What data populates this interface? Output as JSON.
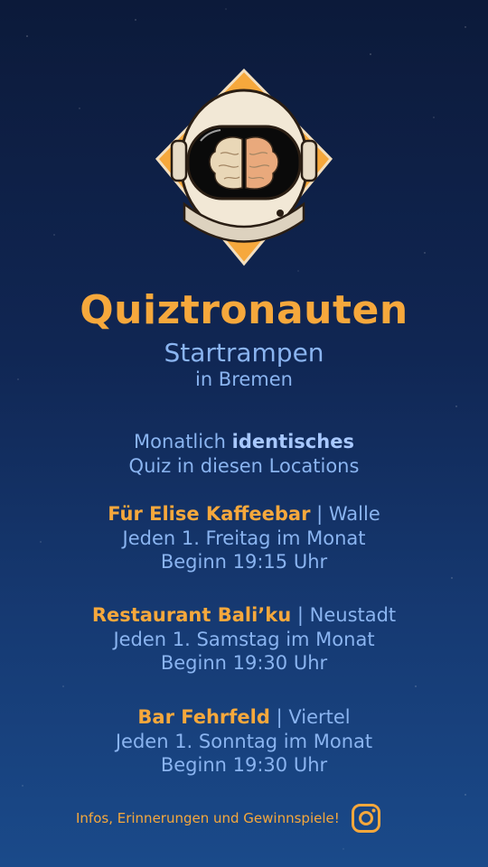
{
  "colors": {
    "accent": "#f6a83c",
    "text": "#8ab4f0",
    "background_top": "#0c1a3a",
    "background_bottom": "#1a4a8a"
  },
  "logo": {
    "icon": "astronaut-helmet-brain-icon"
  },
  "title": "Quiztronauten",
  "subtitle": "Startrampen",
  "subline": "in Bremen",
  "intro": {
    "line1_prefix": "Monatlich ",
    "line1_bold": "identisches",
    "line2": "Quiz in diesen Locations"
  },
  "venues": [
    {
      "name": "Für Elise Kaffeebar",
      "sep": " | ",
      "district": "Walle",
      "schedule": "Jeden 1. Freitag im Monat",
      "time": "Beginn 19:15 Uhr"
    },
    {
      "name": "Restaurant Bali’ku",
      "sep": " | ",
      "district": "Neustadt",
      "schedule": "Jeden 1. Samstag im Monat",
      "time": "Beginn 19:30 Uhr"
    },
    {
      "name": "Bar Fehrfeld",
      "sep": " | ",
      "district": "Viertel",
      "schedule": "Jeden 1. Sonntag im Monat",
      "time": "Beginn 19:30 Uhr"
    }
  ],
  "footer": {
    "text": "Infos, Erinnerungen und Gewinnspiele!",
    "icon": "instagram-icon"
  }
}
